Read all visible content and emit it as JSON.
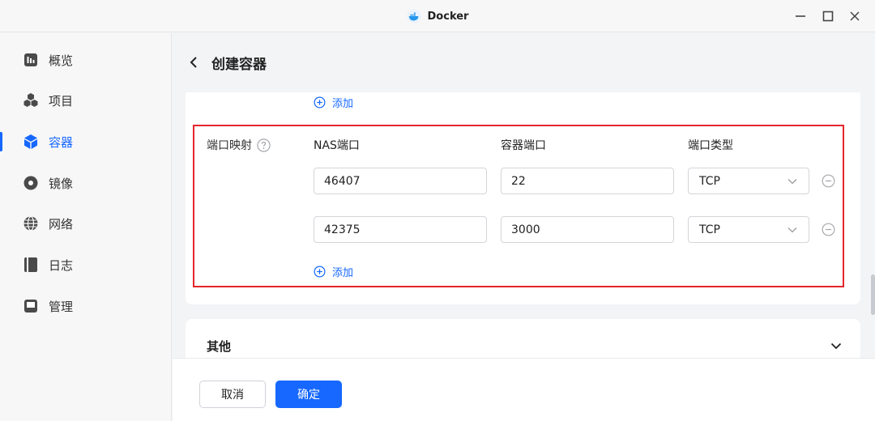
{
  "window": {
    "title": "Docker"
  },
  "sidebar": {
    "items": [
      {
        "label": "概览",
        "icon": "dashboard-icon",
        "active": false
      },
      {
        "label": "项目",
        "icon": "cubes-icon",
        "active": false
      },
      {
        "label": "容器",
        "icon": "cube-icon",
        "active": true
      },
      {
        "label": "镜像",
        "icon": "disc-icon",
        "active": false
      },
      {
        "label": "网络",
        "icon": "globe-icon",
        "active": false
      },
      {
        "label": "日志",
        "icon": "book-icon",
        "active": false
      },
      {
        "label": "管理",
        "icon": "manage-icon",
        "active": false
      }
    ]
  },
  "header": {
    "title": "创建容器"
  },
  "ports": {
    "add_top_label": "添加",
    "label": "端口映射",
    "columns": {
      "nas": "NAS端口",
      "container": "容器端口",
      "type": "端口类型"
    },
    "rows": [
      {
        "nas_port": "46407",
        "container_port": "22",
        "type": "TCP"
      },
      {
        "nas_port": "42375",
        "container_port": "3000",
        "type": "TCP"
      }
    ],
    "add_label": "添加"
  },
  "other": {
    "title": "其他"
  },
  "footer": {
    "cancel_label": "取消",
    "ok_label": "确定"
  },
  "colors": {
    "accent": "#1668ff",
    "highlight": "#e5262b"
  }
}
